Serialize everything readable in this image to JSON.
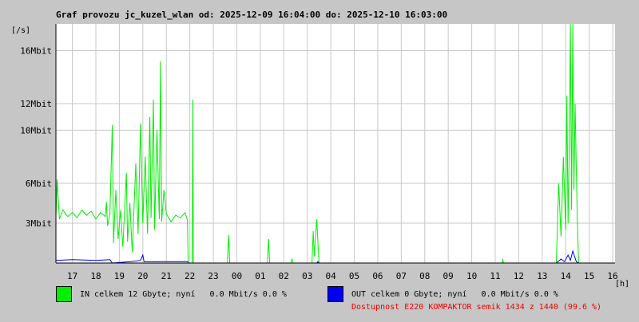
{
  "colors": {
    "background": "#c6c6c6",
    "plot_bg": "#ffffff",
    "grid": "#c8c8c8",
    "in": "#00ee00",
    "out": "#0000ee",
    "availability": "#ee0000"
  },
  "chart_data": {
    "type": "line",
    "title": "Graf provozu jc_kuzel_wlan od: 2025-12-09 16:04:00 do: 2025-12-10 16:03:00",
    "ylabel": "[/s]",
    "xlabel": "[h]",
    "x_tick_labels": [
      "17",
      "18",
      "19",
      "20",
      "21",
      "22",
      "23",
      "00",
      "01",
      "02",
      "03",
      "04",
      "05",
      "06",
      "07",
      "08",
      "09",
      "10",
      "11",
      "12",
      "13",
      "14",
      "15",
      "16"
    ],
    "y_tick_labels": [
      {
        "value": 3,
        "label": "3Mbit"
      },
      {
        "value": 6,
        "label": "6Mbit"
      },
      {
        "value": 10,
        "label": "10Mbit"
      },
      {
        "value": 12,
        "label": "12Mbit"
      },
      {
        "value": 16,
        "label": "16Mbit"
      }
    ],
    "ylim": [
      0,
      18
    ],
    "x_range": [
      16.3,
      40.1
    ],
    "grid": true,
    "series": [
      {
        "name": "IN",
        "color": "#00ee00",
        "points": [
          [
            16.3,
            3.5
          ],
          [
            16.35,
            6.3
          ],
          [
            16.45,
            3.3
          ],
          [
            16.6,
            4.0
          ],
          [
            16.8,
            3.5
          ],
          [
            17.0,
            3.8
          ],
          [
            17.2,
            3.4
          ],
          [
            17.4,
            4.0
          ],
          [
            17.6,
            3.6
          ],
          [
            17.8,
            3.9
          ],
          [
            18.0,
            3.3
          ],
          [
            18.2,
            3.8
          ],
          [
            18.4,
            3.5
          ],
          [
            18.45,
            4.6
          ],
          [
            18.5,
            2.8
          ],
          [
            18.6,
            3.7
          ],
          [
            18.7,
            10.4
          ],
          [
            18.75,
            1.5
          ],
          [
            18.85,
            5.5
          ],
          [
            18.95,
            1.8
          ],
          [
            19.05,
            4.0
          ],
          [
            19.15,
            1.2
          ],
          [
            19.3,
            6.8
          ],
          [
            19.35,
            1.6
          ],
          [
            19.45,
            4.5
          ],
          [
            19.55,
            0.8
          ],
          [
            19.7,
            7.5
          ],
          [
            19.8,
            2.2
          ],
          [
            19.9,
            10.5
          ],
          [
            20.0,
            3.0
          ],
          [
            20.1,
            8.0
          ],
          [
            20.2,
            2.2
          ],
          [
            20.3,
            11.0
          ],
          [
            20.35,
            3.4
          ],
          [
            20.45,
            12.3
          ],
          [
            20.5,
            2.5
          ],
          [
            20.6,
            10.0
          ],
          [
            20.7,
            3.3
          ],
          [
            20.75,
            15.2
          ],
          [
            20.8,
            3.1
          ],
          [
            20.9,
            5.5
          ],
          [
            21.0,
            3.7
          ],
          [
            21.2,
            3.1
          ],
          [
            21.4,
            3.6
          ],
          [
            21.6,
            3.4
          ],
          [
            21.8,
            3.8
          ],
          [
            21.9,
            3.2
          ],
          [
            21.93,
            0.0
          ],
          [
            22.1,
            0.0
          ],
          [
            22.13,
            12.3
          ],
          [
            22.15,
            0.0
          ],
          [
            23.6,
            0.0
          ],
          [
            23.65,
            2.1
          ],
          [
            23.7,
            0.0
          ],
          [
            25.3,
            0.0
          ],
          [
            25.35,
            1.8
          ],
          [
            25.4,
            0.0
          ],
          [
            26.3,
            0.0
          ],
          [
            26.35,
            0.3
          ],
          [
            26.4,
            0.0
          ],
          [
            27.2,
            0.0
          ],
          [
            27.25,
            2.4
          ],
          [
            27.3,
            0.5
          ],
          [
            27.4,
            3.3
          ],
          [
            27.5,
            0.0
          ],
          [
            35.3,
            0.0
          ],
          [
            35.32,
            0.3
          ],
          [
            35.35,
            0.0
          ],
          [
            37.6,
            0.0
          ],
          [
            37.7,
            6.0
          ],
          [
            37.8,
            2.0
          ],
          [
            37.9,
            8.0
          ],
          [
            38.0,
            2.5
          ],
          [
            38.05,
            12.6
          ],
          [
            38.1,
            3.0
          ],
          [
            38.15,
            8.5
          ],
          [
            38.2,
            18.0
          ],
          [
            38.25,
            4.0
          ],
          [
            38.3,
            18.0
          ],
          [
            38.35,
            5.5
          ],
          [
            38.4,
            12.0
          ],
          [
            38.45,
            7.0
          ],
          [
            38.5,
            3.0
          ],
          [
            38.55,
            0.0
          ],
          [
            40.1,
            0.0
          ]
        ]
      },
      {
        "name": "OUT",
        "color": "#0000ee",
        "points": [
          [
            16.3,
            0.2
          ],
          [
            17.0,
            0.25
          ],
          [
            18.0,
            0.2
          ],
          [
            18.6,
            0.25
          ],
          [
            18.7,
            0.0
          ],
          [
            19.5,
            0.1
          ],
          [
            19.9,
            0.2
          ],
          [
            20.0,
            0.6
          ],
          [
            20.05,
            0.1
          ],
          [
            21.0,
            0.1
          ],
          [
            21.9,
            0.1
          ],
          [
            21.95,
            0.0
          ],
          [
            27.4,
            0.0
          ],
          [
            27.45,
            0.1
          ],
          [
            27.5,
            0.0
          ],
          [
            37.6,
            0.0
          ],
          [
            37.8,
            0.3
          ],
          [
            37.95,
            0.1
          ],
          [
            38.1,
            0.6
          ],
          [
            38.2,
            0.2
          ],
          [
            38.3,
            0.9
          ],
          [
            38.45,
            0.1
          ],
          [
            38.55,
            0.0
          ],
          [
            40.1,
            0.0
          ]
        ]
      }
    ]
  },
  "legend": {
    "in_text": "IN celkem 12 Gbyte; nyní   0.0 Mbit/s 0.0 %",
    "out_text": "OUT celkem 0 Gbyte; nyní   0.0 Mbit/s 0.0 %",
    "availability_text": "Dostupnost E220 KOMPAKTOR semik 1434 z 1440 (99.6 %)"
  }
}
